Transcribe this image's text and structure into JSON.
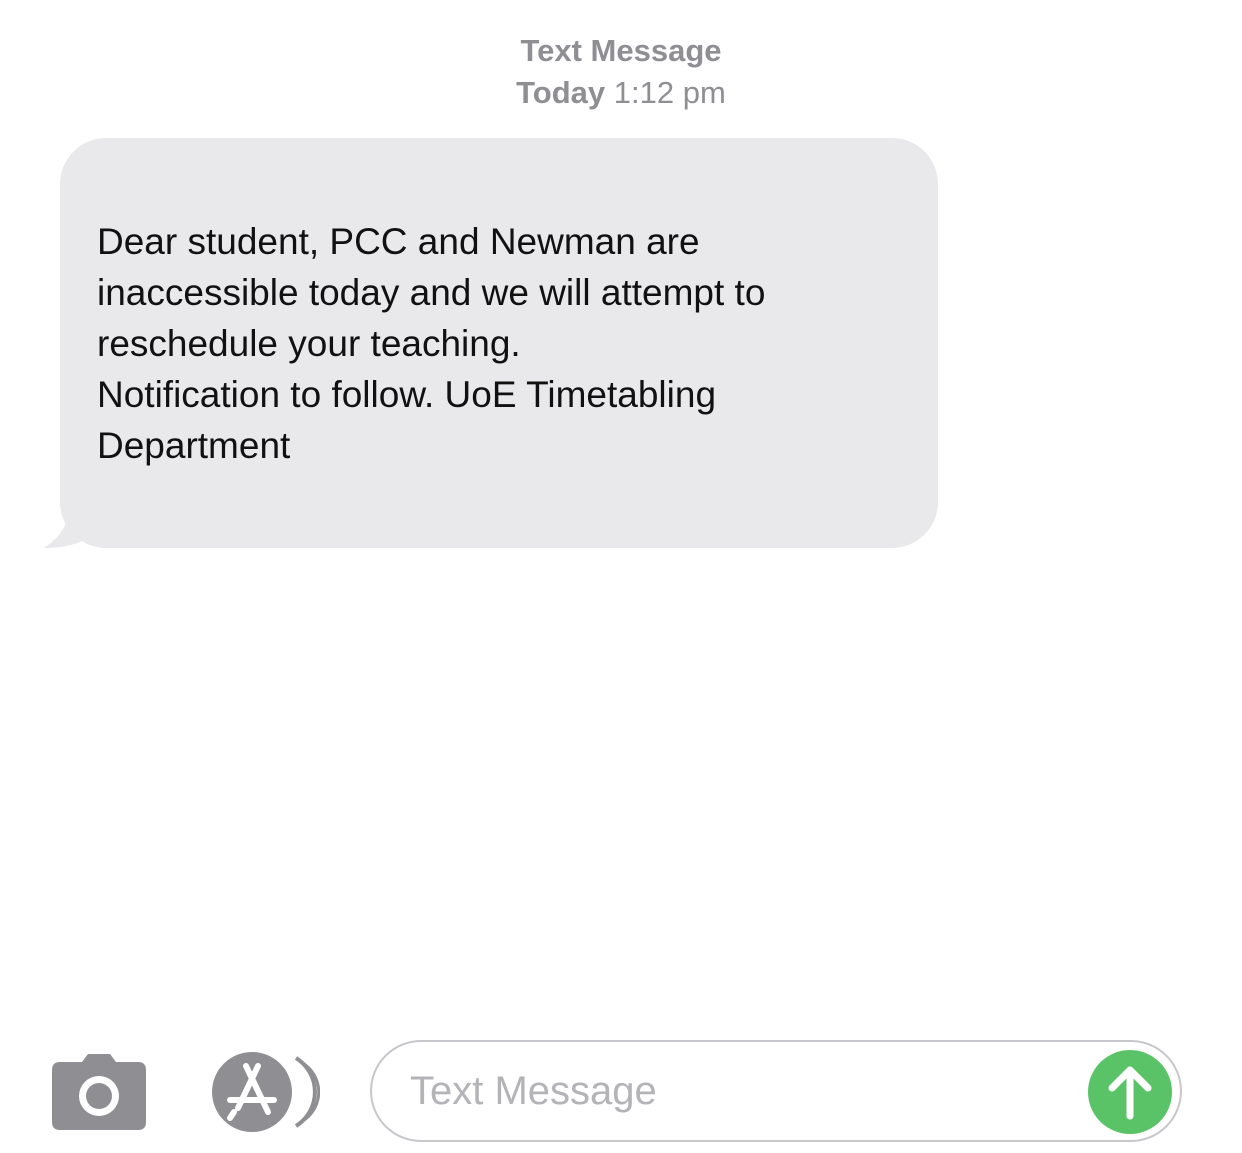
{
  "header": {
    "service": "Text Message",
    "day": "Today",
    "time": "1:12 pm"
  },
  "message": {
    "lines": [
      "Dear student, PCC and Newman are",
      "inaccessible today and we will attempt to",
      "reschedule your teaching.",
      "Notification to follow. UoE Timetabling",
      "Department"
    ]
  },
  "composer": {
    "placeholder": "Text Message",
    "camera_icon": "camera-icon",
    "appstore_icon": "app-store-icon",
    "send_icon": "arrow-up-icon"
  },
  "colors": {
    "incoming_bubble": "#e9e9eb",
    "send_button": "#5ac367",
    "meta_text": "#8e8e93",
    "icon_gray": "#8e8e93"
  }
}
